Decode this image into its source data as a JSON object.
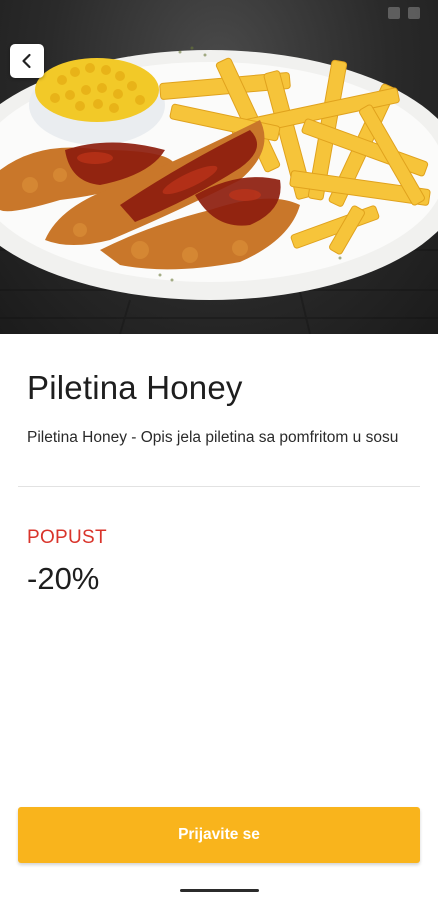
{
  "hero": {
    "image_icon": "chicken-fries-plate-photo"
  },
  "header": {
    "back_icon": "chevron-left-icon"
  },
  "product": {
    "title": "Piletina Honey",
    "description": "Piletina Honey - Opis jela piletina sa pomfritom u sosu"
  },
  "discount": {
    "label": "POPUST",
    "value": "-20%"
  },
  "footer": {
    "login_label": "Prijavite se"
  },
  "colors": {
    "accent": "#f9b41c",
    "discount_label": "#d9342b",
    "title": "#1e1e1e"
  }
}
